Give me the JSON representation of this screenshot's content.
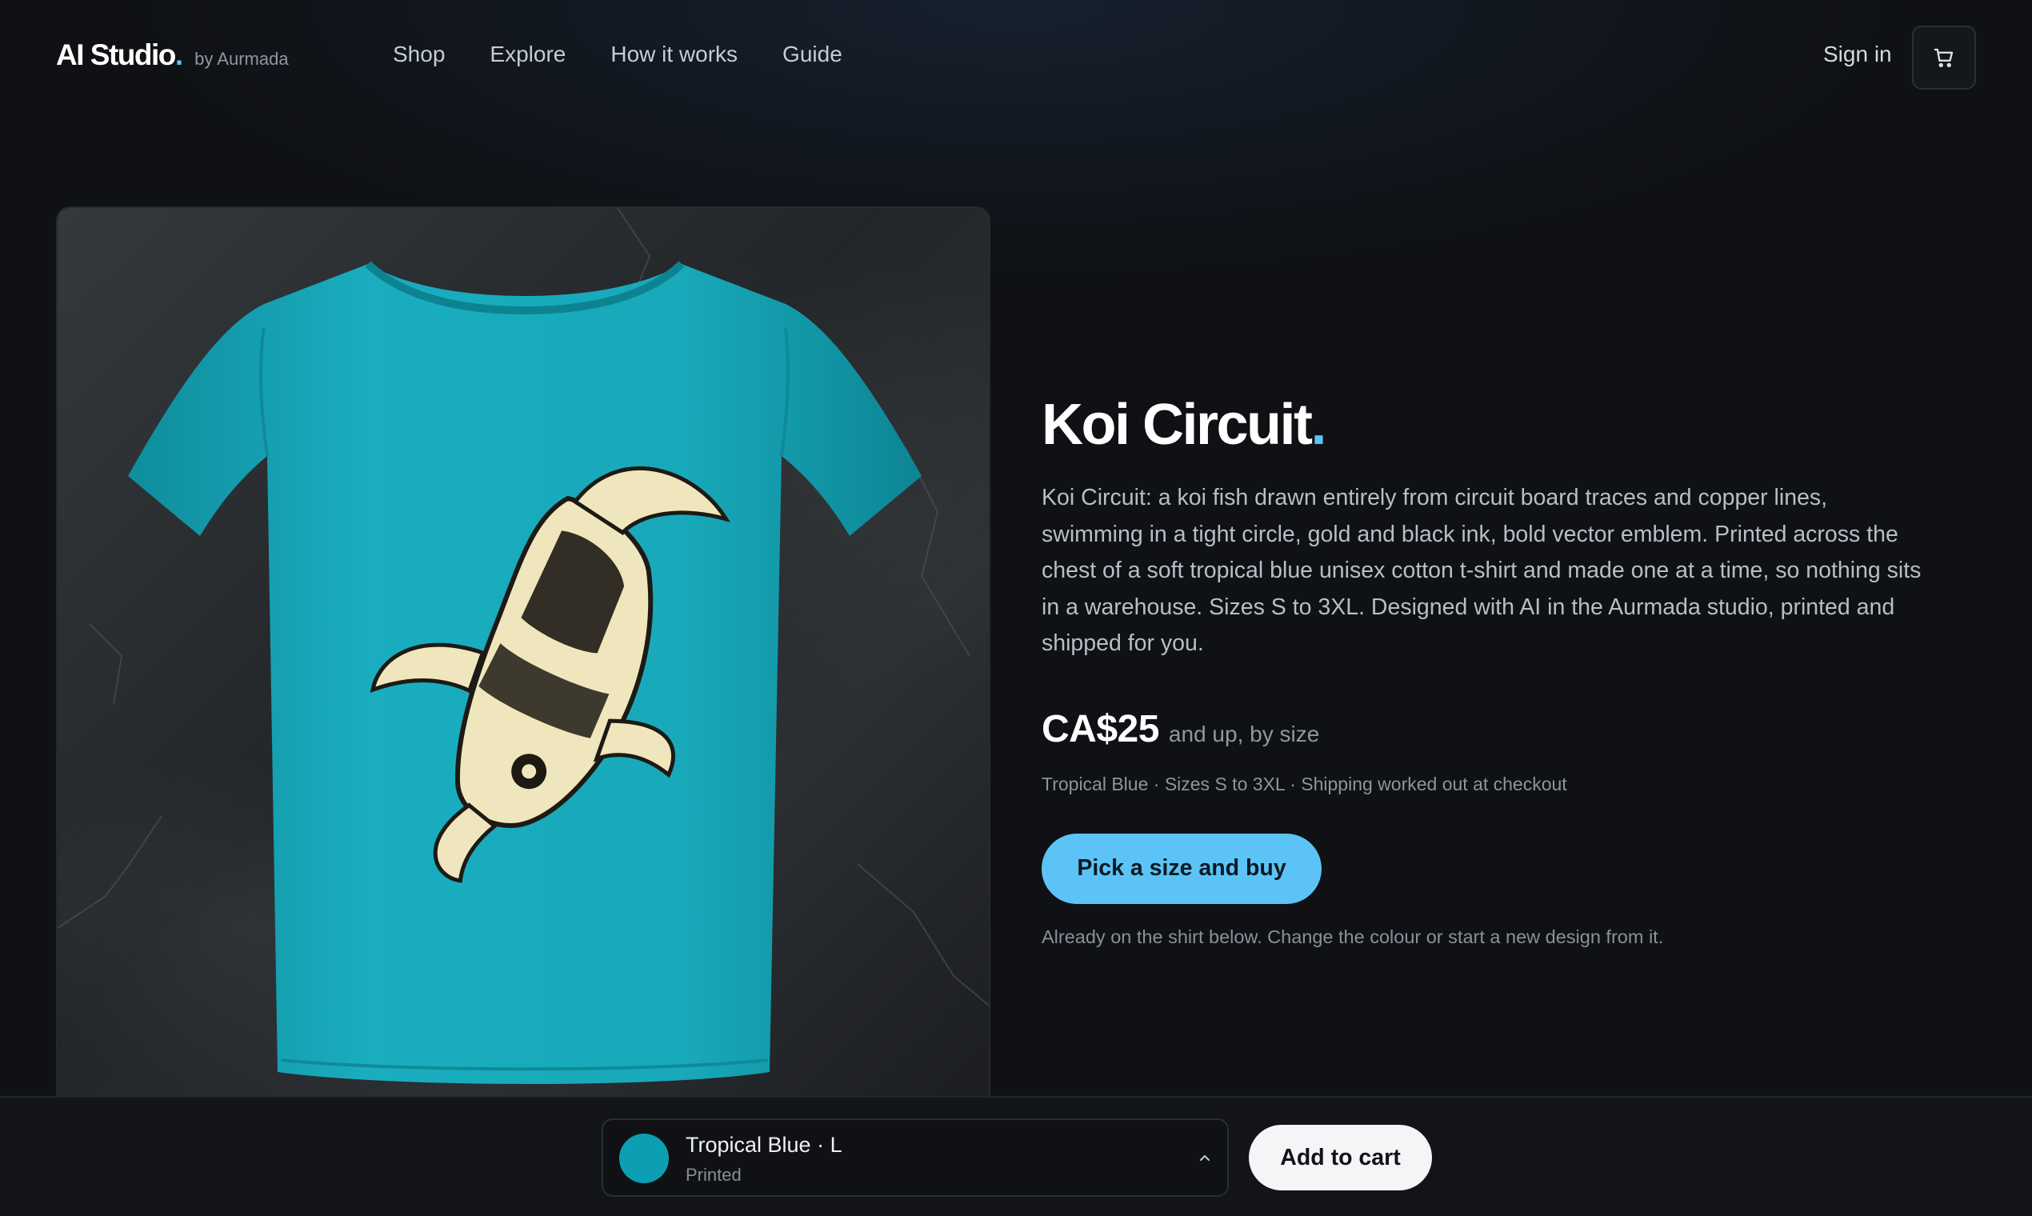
{
  "header": {
    "brand_name": "AI Studio",
    "brand_dot": ".",
    "brand_by": "by Aurmada",
    "nav": [
      "Shop",
      "Explore",
      "How it works",
      "Guide"
    ],
    "sign_in": "Sign in",
    "cart_icon": "cart-icon"
  },
  "product": {
    "title": "Koi Circuit",
    "title_dot": ".",
    "description": "Koi Circuit: a koi fish drawn entirely from circuit board traces and copper lines, swimming in a tight circle, gold and black ink, bold vector emblem. Printed across the chest of a soft tropical blue unisex cotton t-shirt and made one at a time, so nothing sits in a warehouse. Sizes S to 3XL. Designed with AI in the Aurmada studio, printed and shipped for you.",
    "price": "CA$25",
    "price_note": "and up, by size",
    "specs": "Tropical Blue · Sizes S to 3XL · Shipping worked out at checkout",
    "buy_label": "Pick a size and buy",
    "hint": "Already on the shirt below. Change the colour or start a new design from it.",
    "shirt_color": "#17a9bb",
    "accent_color": "#5bc3f5"
  },
  "bottom_bar": {
    "variant_label": "Tropical Blue · L",
    "variant_sub": "Printed",
    "swatch_color": "#0c9fb3",
    "chevron_icon": "chevron-up-icon",
    "add_to_cart": "Add to cart"
  }
}
